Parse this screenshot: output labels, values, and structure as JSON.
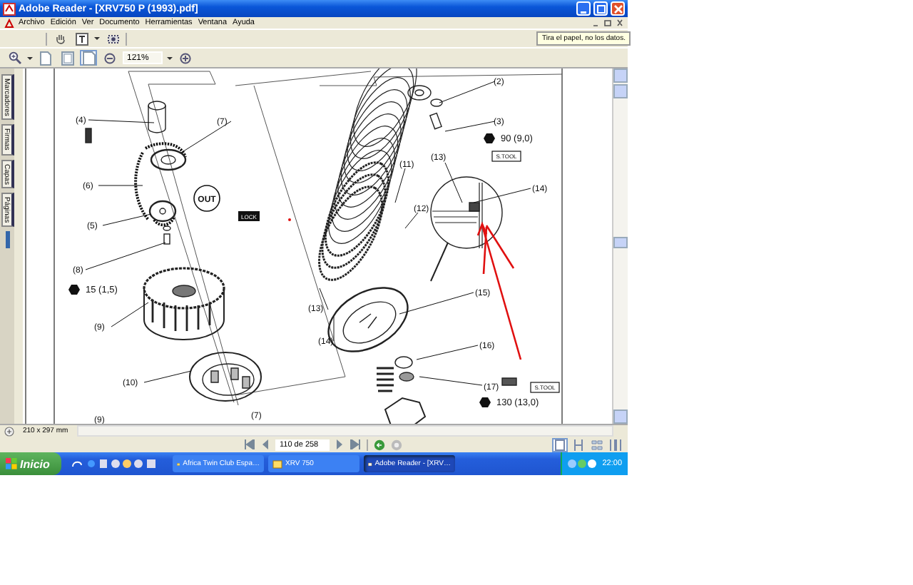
{
  "window": {
    "title": "Adobe Reader - [XRV750 P (1993).pdf]"
  },
  "menu": [
    "Archivo",
    "Edición",
    "Ver",
    "Documento",
    "Herramientas",
    "Ventana",
    "Ayuda"
  ],
  "tooltip": "Tira el papel, no los datos.",
  "zoom": "121%",
  "side_tabs": [
    "Marcadores",
    "Firmas",
    "Capas",
    "Páginas"
  ],
  "drawing": {
    "part_labels": [
      "(4)",
      "(7)",
      "(6)",
      "(5)",
      "(8)",
      "(9)",
      "(10)",
      "(9)",
      "(7)",
      "(2)",
      "(3)",
      "(13)",
      "(14)",
      "(11)",
      "(12)",
      "(13)",
      "(14)",
      "(15)",
      "(16)",
      "(17)"
    ],
    "torque_specs": [
      "15 (1,5)",
      "90 (9,0)",
      "130 (13,0)"
    ],
    "out_mark": "OUT",
    "lock_mark": "LOCK",
    "tool_marks": [
      "S.TOOL",
      "S.TOOL"
    ]
  },
  "page_size": "210 x 297 mm",
  "page_nav": "110 de 258",
  "taskbar": {
    "start": "Inicio",
    "tasks": [
      {
        "label": "Africa Twin Club Espa…",
        "selected": false
      },
      {
        "label": "XRV 750",
        "selected": false
      },
      {
        "label": "Adobe Reader - [XRV…",
        "selected": true
      }
    ],
    "clock": "22:00"
  }
}
